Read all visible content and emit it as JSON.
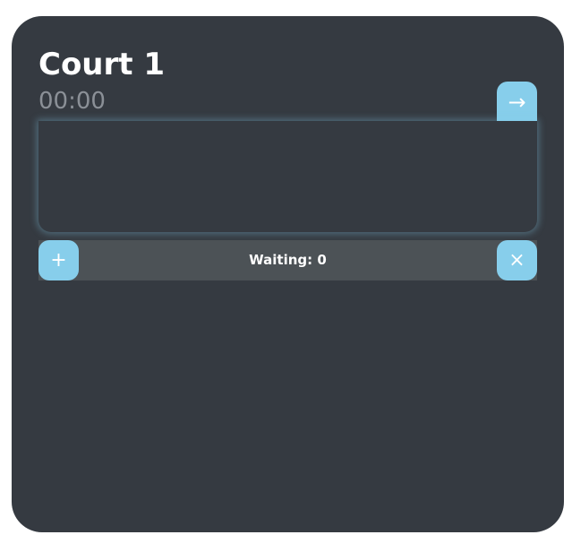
{
  "court": {
    "title": "Court 1",
    "timer": "00:00",
    "next_icon": "→"
  },
  "queue": {
    "label": "Waiting: 0",
    "add_icon": "+",
    "clear_icon": "×"
  },
  "colors": {
    "card_bg": "#353a41",
    "accent": "#87ceeb",
    "queue_bar_bg": "#4c5256",
    "timer_text": "#8b9097"
  }
}
